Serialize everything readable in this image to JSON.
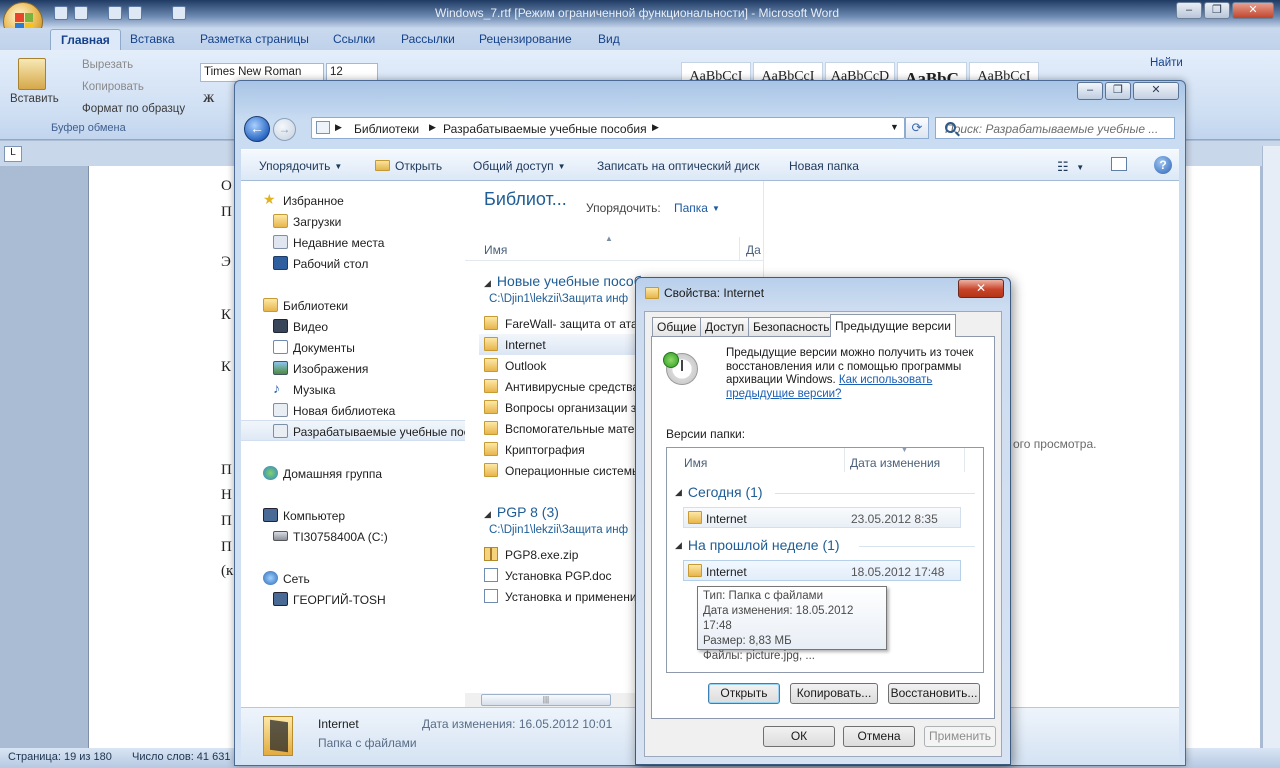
{
  "word": {
    "title": "Windows_7.rtf [Режим ограниченной функциональности] - Microsoft Word",
    "tabs": [
      "Главная",
      "Вставка",
      "Разметка страницы",
      "Ссылки",
      "Рассылки",
      "Рецензирование",
      "Вид"
    ],
    "clipboard": {
      "paste": "Вставить",
      "cut": "Вырезать",
      "copy": "Копировать",
      "format_painter": "Формат по образцу",
      "group": "Буфер обмена"
    },
    "font_name": "Times New Roman",
    "font_size": "12",
    "styles": [
      "AaBbCcI",
      "AaBbCcI",
      "AaBbCcD",
      "AaBbC",
      "AaBbCcI"
    ],
    "find": "Найти",
    "doc_fragments": [
      "О",
      "П",
      "Э",
      "К",
      "К",
      "П",
      "Н",
      "П",
      "П",
      "(к"
    ],
    "status_page": "Страница: 19 из 180",
    "status_words": "Число слов: 41 631"
  },
  "explorer": {
    "address": [
      "Библиотеки",
      "Разрабатываемые учебные пособия"
    ],
    "search_placeholder": "Поиск: Разрабатываемые учебные ...",
    "toolbar": [
      "Упорядочить",
      "Открыть",
      "Общий доступ",
      "Записать на оптический диск",
      "Новая папка"
    ],
    "nav": {
      "favorites": "Избранное",
      "downloads": "Загрузки",
      "recent": "Недавние места",
      "desktop": "Рабочий стол",
      "libraries": "Библиотеки",
      "video": "Видео",
      "documents": "Документы",
      "images": "Изображения",
      "music": "Музыка",
      "new_library": "Новая библиотека",
      "dev_library": "Разрабатываемые учебные пособ",
      "homegroup": "Домашняя группа",
      "computer": "Компьютер",
      "drive": "TI30758400A (C:)",
      "network": "Сеть",
      "network_pc": "ГЕОРГИЙ-TOSH"
    },
    "library_title": "Библиот...",
    "arrange_label": "Упорядочить:",
    "arrange_value": "Папка",
    "col_name": "Имя",
    "col_date": "Да",
    "group1": {
      "title": "Новые учебные пособ",
      "path": "C:\\Djin1\\lekzii\\Защита инф",
      "items": [
        "FareWall- защита от атак",
        "Internet",
        "Outlook",
        "Антивирусные средства",
        "Вопросы организации з",
        "Вспомогательные матер",
        "Криптография",
        "Операционные системы"
      ]
    },
    "group2": {
      "title": "PGP 8 (3)",
      "path": "C:\\Djin1\\lekzii\\Защита инф",
      "items": [
        "PGP8.exe.zip",
        "Установка PGP.doc",
        "Установка и применени"
      ]
    },
    "preview_text": "ого просмотра.",
    "details": {
      "name": "Internet",
      "type": "Папка с файлами",
      "modified": "Дата изменения: 16.05.2012 10:01"
    }
  },
  "props": {
    "title": "Свойства: Internet",
    "tabs": [
      "Общие",
      "Доступ",
      "Безопасность",
      "Предыдущие версии"
    ],
    "info": "Предыдущие версии можно получить из точек восстановления или с помощью программы архивации Windows.",
    "info_link": "Как использовать предыдущие версии?",
    "versions_label": "Версии папки:",
    "col_name": "Имя",
    "col_date": "Дата изменения",
    "group_today": "Сегодня (1)",
    "group_lastweek": "На прошлой неделе (1)",
    "item1": {
      "name": "Internet",
      "date": "23.05.2012 8:35"
    },
    "item2": {
      "name": "Internet",
      "date": "18.05.2012 17:48"
    },
    "tooltip": [
      "Тип: Папка с файлами",
      "Дата изменения: 18.05.2012 17:48",
      "Размер: 8,83 МБ",
      "Файлы: picture.jpg, ..."
    ],
    "btn_open": "Открыть",
    "btn_copy": "Копировать...",
    "btn_restore": "Восстановить...",
    "btn_ok": "ОК",
    "btn_cancel": "Отмена",
    "btn_apply": "Применить"
  }
}
